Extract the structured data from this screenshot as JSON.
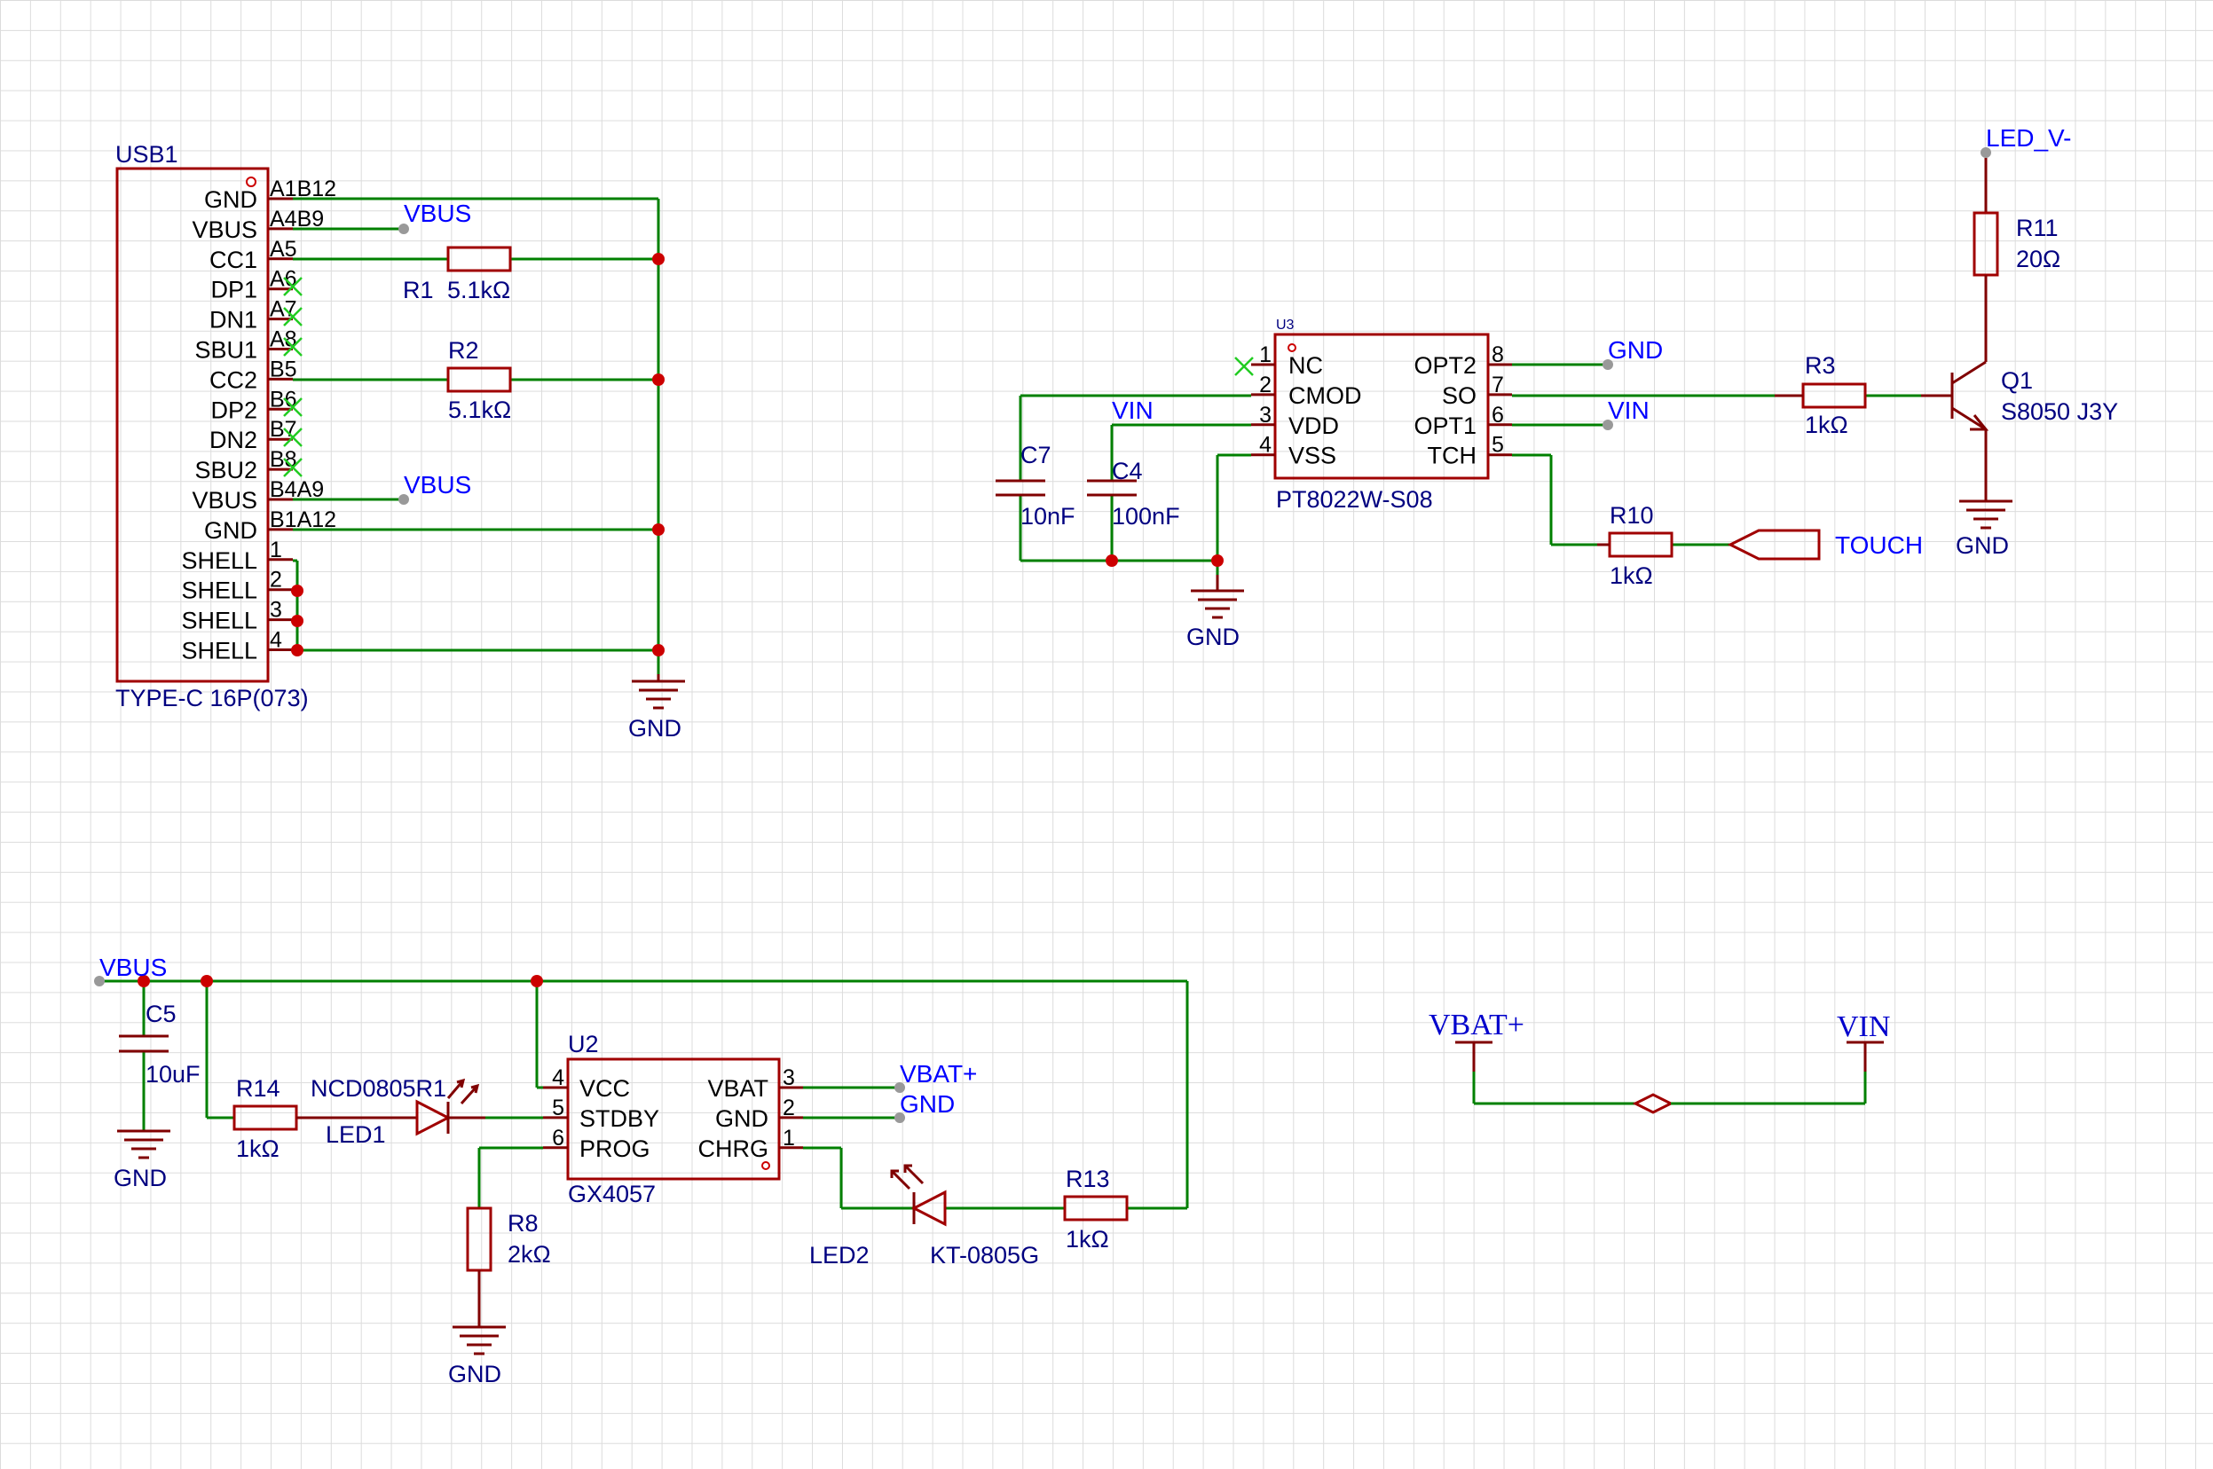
{
  "usb1": {
    "ref": "USB1",
    "value": "TYPE-C 16P(073)",
    "pins": [
      {
        "name": "GND",
        "num": "A1B12"
      },
      {
        "name": "VBUS",
        "num": "A4B9"
      },
      {
        "name": "CC1",
        "num": "A5"
      },
      {
        "name": "DP1",
        "num": "A6"
      },
      {
        "name": "DN1",
        "num": "A7"
      },
      {
        "name": "SBU1",
        "num": "A8"
      },
      {
        "name": "CC2",
        "num": "B5"
      },
      {
        "name": "DP2",
        "num": "B6"
      },
      {
        "name": "DN2",
        "num": "B7"
      },
      {
        "name": "SBU2",
        "num": "B8"
      },
      {
        "name": "VBUS",
        "num": "B4A9"
      },
      {
        "name": "GND",
        "num": "B1A12"
      },
      {
        "name": "SHELL",
        "num": "1"
      },
      {
        "name": "SHELL",
        "num": "2"
      },
      {
        "name": "SHELL",
        "num": "3"
      },
      {
        "name": "SHELL",
        "num": "4"
      }
    ],
    "net_vbus_top": "VBUS",
    "net_vbus_bottom": "VBUS",
    "gnd": "GND"
  },
  "r1": {
    "ref": "R1",
    "value": "5.1kΩ"
  },
  "r2": {
    "ref": "R2",
    "value": "5.1kΩ"
  },
  "u3": {
    "ref": "U3",
    "value": "PT8022W-S08",
    "left_pins": [
      {
        "num": "1",
        "name": "NC"
      },
      {
        "num": "2",
        "name": "CMOD"
      },
      {
        "num": "3",
        "name": "VDD"
      },
      {
        "num": "4",
        "name": "VSS"
      }
    ],
    "right_pins": [
      {
        "num": "8",
        "name": "OPT2"
      },
      {
        "num": "7",
        "name": "SO"
      },
      {
        "num": "6",
        "name": "OPT1"
      },
      {
        "num": "5",
        "name": "TCH"
      }
    ],
    "net_gnd": "GND",
    "net_vin_right": "VIN",
    "net_vin_left": "VIN",
    "gnd_bottom": "GND"
  },
  "c7": {
    "ref": "C7",
    "value": "10nF"
  },
  "c4": {
    "ref": "C4",
    "value": "100nF"
  },
  "r3": {
    "ref": "R3",
    "value": "1kΩ"
  },
  "r10": {
    "ref": "R10",
    "value": "1kΩ"
  },
  "touch": "TOUCH",
  "r11": {
    "ref": "R11",
    "value": "20Ω"
  },
  "led_v": "LED_V-",
  "q1": {
    "ref": "Q1",
    "value": "S8050 J3Y",
    "gnd": "GND"
  },
  "charger": {
    "net_vbus": "VBUS",
    "c5": {
      "ref": "C5",
      "value": "10uF",
      "gnd": "GND"
    },
    "r14": {
      "ref": "R14",
      "value": "1kΩ"
    },
    "led1": {
      "ref": "LED1",
      "value": "NCD0805R1"
    },
    "u2": {
      "ref": "U2",
      "value": "GX4057",
      "left_pins": [
        {
          "num": "4",
          "name": "VCC"
        },
        {
          "num": "5",
          "name": "STDBY"
        },
        {
          "num": "6",
          "name": "PROG"
        }
      ],
      "right_pins": [
        {
          "num": "3",
          "name": "VBAT"
        },
        {
          "num": "2",
          "name": "GND"
        },
        {
          "num": "1",
          "name": "CHRG"
        }
      ]
    },
    "net_vbat": "VBAT+",
    "net_gnd": "GND",
    "r8": {
      "ref": "R8",
      "value": "2kΩ",
      "gnd": "GND"
    },
    "led2": {
      "ref": "LED2",
      "value": "KT-0805G"
    },
    "r13": {
      "ref": "R13",
      "value": "1kΩ"
    }
  },
  "power_tie": {
    "left": "VBAT+",
    "right": "VIN"
  }
}
